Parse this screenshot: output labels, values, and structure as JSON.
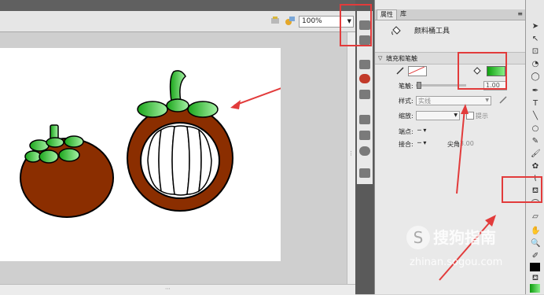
{
  "toolbar": {
    "zoom": "100%"
  },
  "properties": {
    "tabs": [
      "属性",
      "库"
    ],
    "tool_name": "颜料桶工具",
    "section_title": "填充和笔触",
    "stroke_width_label": "笔触:",
    "stroke_width_value": "1.00",
    "style_label": "样式:",
    "style_value": "实线",
    "scale_label": "缩放:",
    "hint_label": "提示",
    "cap_label": "端点:",
    "join_label": "接合:",
    "miter_label": "尖角:",
    "miter_value": "3.00"
  },
  "watermark": {
    "brand": "搜狗指南",
    "url": "zhinan.sogou.com"
  },
  "colors": {
    "mangosteen_body": "#8b2e00",
    "leaf_dark": "#1aa51a",
    "leaf_light": "#a6f2a6",
    "annotation_red": "#e23b3b",
    "fill_gradient_start": "#0fa00f",
    "fill_gradient_end": "#86f086"
  },
  "icons": [
    "brush-icon",
    "grid-icon",
    "paint-bucket-icon",
    "arrow-tool-icon",
    "subselect-icon",
    "lasso-icon",
    "pen-icon",
    "text-icon",
    "line-icon",
    "pencil-icon",
    "bucket-tool-icon",
    "hand-icon",
    "zoom-icon"
  ]
}
